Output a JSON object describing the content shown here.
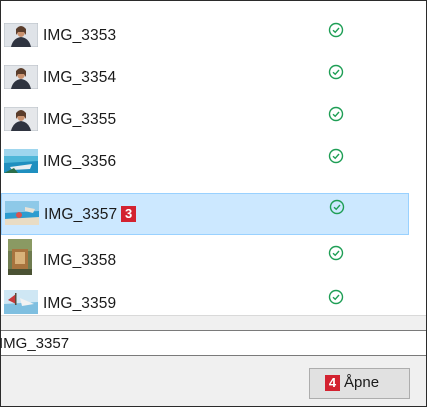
{
  "files": [
    {
      "name": "IMG_3353",
      "status_icon": "check-circle-icon",
      "thumbnail": "portrait-person",
      "selected": false
    },
    {
      "name": "IMG_3354",
      "status_icon": "check-circle-icon",
      "thumbnail": "portrait-person",
      "selected": false
    },
    {
      "name": "IMG_3355",
      "status_icon": "check-circle-icon",
      "thumbnail": "portrait-person",
      "selected": false
    },
    {
      "name": "IMG_3356",
      "status_icon": "check-circle-icon",
      "thumbnail": "landscape-sea",
      "selected": false
    },
    {
      "name": "IMG_3357",
      "status_icon": "check-circle-icon",
      "thumbnail": "landscape-beach",
      "selected": true,
      "marker": "3"
    },
    {
      "name": "IMG_3358",
      "status_icon": "check-circle-icon",
      "thumbnail": "portrait-painting",
      "selected": false
    },
    {
      "name": "IMG_3359",
      "status_icon": "check-circle-icon",
      "thumbnail": "landscape-boat",
      "selected": false
    }
  ],
  "filename_field": {
    "value": "IMG_3357"
  },
  "open_button": {
    "marker": "4",
    "label": "Åpne"
  },
  "colors": {
    "selection": "#cce8ff",
    "selection_border": "#99d1ff",
    "sync_ok": "#1e9e55",
    "marker": "#d32230"
  }
}
